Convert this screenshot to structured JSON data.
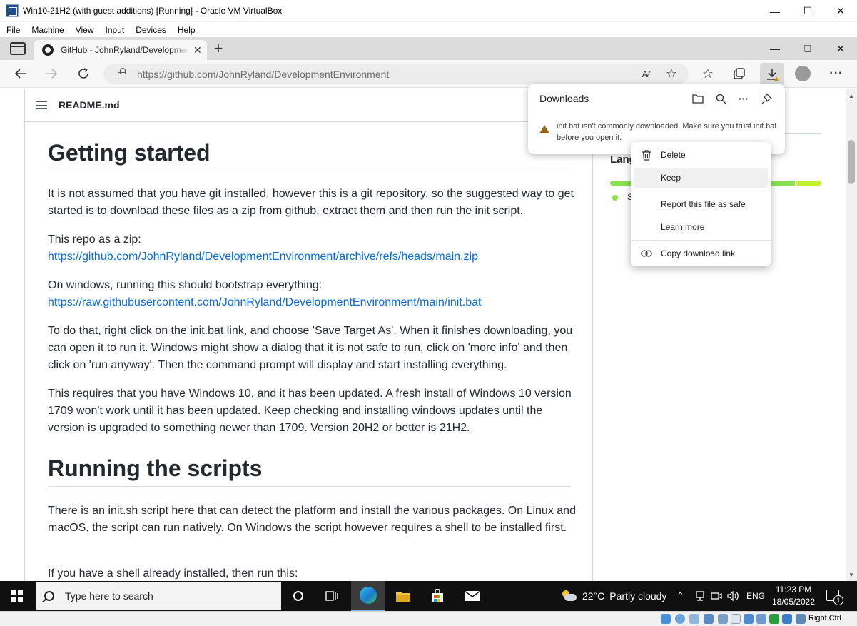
{
  "vbox": {
    "title": "Win10-21H2 (with guest additions) [Running] - Oracle VM VirtualBox",
    "menu": [
      "File",
      "Machine",
      "View",
      "Input",
      "Devices",
      "Help"
    ],
    "host_key": "Right Ctrl"
  },
  "browser": {
    "tab_title": "GitHub - JohnRyland/DevelopmentEnvironment",
    "url": "https://github.com/JohnRyland/DevelopmentEnvironment"
  },
  "readme": {
    "filename": "README.md",
    "heading1": "Getting started",
    "p1": "It is not assumed that you have git installed, however this is a git repository, so the suggested way to get started is to download these files as a zip from github, extract them and then run the init script.",
    "p2_label": "This repo as a zip:",
    "p2_link": "https://github.com/JohnRyland/DevelopmentEnvironment/archive/refs/heads/main.zip",
    "p3_label": "On windows, running this should bootstrap everything:",
    "p3_link": "https://raw.githubusercontent.com/JohnRyland/DevelopmentEnvironment/main/init.bat",
    "p4": "To do that, right click on the init.bat link, and choose 'Save Target As'. When it finishes downloading, you can open it to run it. Windows might show a dialog that it is not safe to run, click on 'more info' and then click on 'run anyway'. Then the command prompt will display and start installing everything.",
    "p5": "This requires that you have Windows 10, and it has been updated. A fresh install of Windows 10 version 1709 won't work until it has been updated. Keep checking and installing windows updates until the version is upgraded to something newer than 1709. Version 20H2 or better is 21H2.",
    "heading2": "Running the scripts",
    "p6": "There is an init.sh script here that can detect the platform and install the various packages. On Linux and macOS, the script can run natively. On Windows the script however requires a shell to be installed first.",
    "p7": "If you have a shell already installed, then run this:"
  },
  "sidebar": {
    "languages_heading": "Lang",
    "lang1": "S",
    "bar_colors": [
      "#89e051",
      "#c1f12e"
    ],
    "bar_fraction": [
      0.88,
      0.12
    ]
  },
  "downloads": {
    "title": "Downloads",
    "warning": "init.bat isn't commonly downloaded. Make sure you trust init.bat before you open it."
  },
  "context_menu": {
    "delete": "Delete",
    "keep": "Keep",
    "report": "Report this file as safe",
    "learn_more": "Learn more",
    "copy_link": "Copy download link"
  },
  "taskbar": {
    "search_placeholder": "Type here to search",
    "weather_temp": "22°C",
    "weather_desc": "Partly cloudy",
    "language": "ENG",
    "time": "11:23 PM",
    "date": "18/05/2022",
    "notifications": "1"
  },
  "colors": {
    "link": "#0969da",
    "taskbar_bg": "#101010",
    "warning": "#9d5d00"
  }
}
